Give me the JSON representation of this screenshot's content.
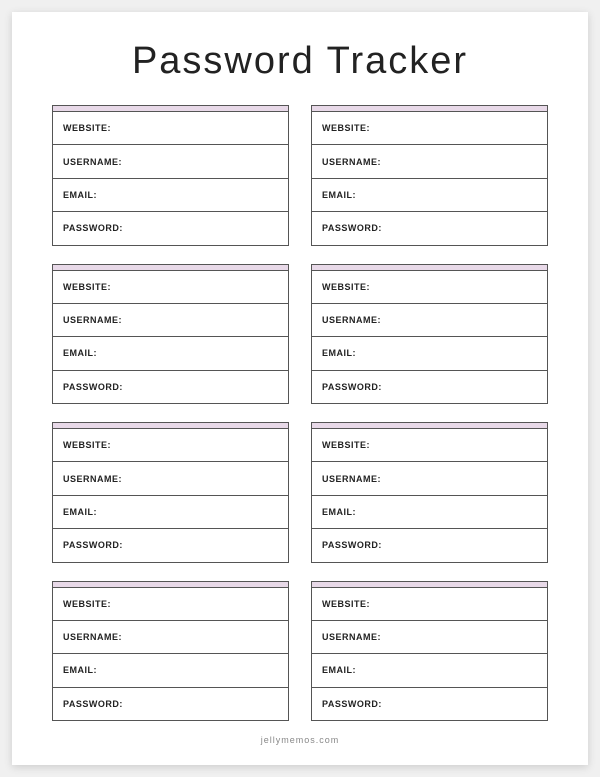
{
  "title": "Password Tracker",
  "fields": {
    "website": "WEBSITE:",
    "username": "USERNAME:",
    "email": "EMAIL:",
    "password": "PASSWORD:"
  },
  "footer": "jellymemos.com",
  "colors": {
    "accent": "#e8d9e8"
  }
}
